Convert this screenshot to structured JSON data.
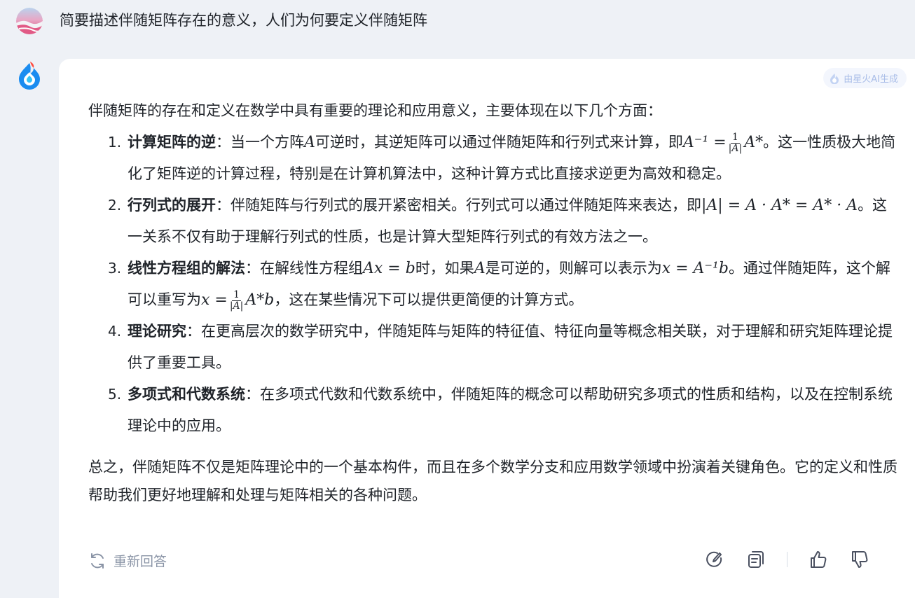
{
  "user": {
    "question": "简要描述伴随矩阵存在的意义，人们为何要定义伴随矩阵"
  },
  "answer": {
    "badge": "由星火AI生成",
    "intro": "伴随矩阵的存在和定义在数学中具有重要的理论和应用意义，主要体现在以下几个方面：",
    "points": [
      {
        "num": "1.",
        "title": "计算矩阵的逆",
        "t1": "：当一个方阵",
        "m1": "A",
        "t2": "可逆时，其逆矩阵可以通过伴随矩阵和行列式来计算，即",
        "m2": "A⁻¹ =",
        "frac_top": "1",
        "frac_bot": "|A|",
        "m3": "A*",
        "t3": "。这一性质极大地简化了矩阵逆的计算过程，特别是在计算机算法中，这种计算方式比直接求逆更为高效和稳定。"
      },
      {
        "num": "2.",
        "title": "行列式的展开",
        "t1": "：伴随矩阵与行列式的展开紧密相关。行列式可以通过伴随矩阵来表达，即",
        "m1": "|A| = A · A* = A* · A",
        "t2": "。这一关系不仅有助于理解行列式的性质，也是计算大型矩阵行列式的有效方法之一。"
      },
      {
        "num": "3.",
        "title": "线性方程组的解法",
        "t1": "：在解线性方程组",
        "m1": "Ax = b",
        "t2": "时，如果",
        "m2": "A",
        "t3": "是可逆的，则解可以表示为",
        "m3": "x = A⁻¹b",
        "t4": "。通过伴随矩阵，这个解可以重写为",
        "m4": "x =",
        "frac_top": "1",
        "frac_bot": "|A|",
        "m5": "A*b",
        "t5": "，这在某些情况下可以提供更简便的计算方式。"
      },
      {
        "num": "4.",
        "title": "理论研究",
        "t1": "：在更高层次的数学研究中，伴随矩阵与矩阵的特征值、特征向量等概念相关联，对于理解和研究矩阵理论提供了重要工具。"
      },
      {
        "num": "5.",
        "title": "多项式和代数系统",
        "t1": "：在多项式代数和代数系统中，伴随矩阵的概念可以帮助研究多项式的性质和结构，以及在控制系统理论中的应用。"
      }
    ],
    "summary": "总之，伴随矩阵不仅是矩阵理论中的一个基本构件，而且在多个数学分支和应用数学领域中扮演着关键角色。它的定义和性质帮助我们更好地理解和处理与矩阵相关的各种问题。"
  },
  "actions": {
    "regenerate_label": "重新回答",
    "icons": [
      "refresh-icon",
      "rewrite-icon",
      "copy-icon",
      "thumbs-up-icon",
      "thumbs-down-icon"
    ]
  },
  "colors": {
    "background": "#eef1f6",
    "card": "#ffffff",
    "muted": "#8a94a6",
    "badge_text": "#a9bde8"
  }
}
